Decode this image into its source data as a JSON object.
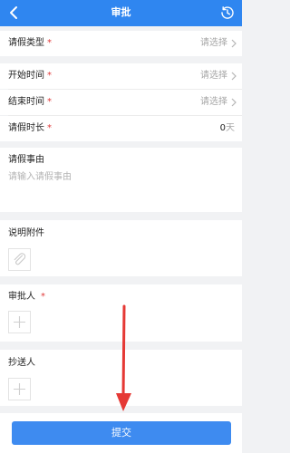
{
  "header": {
    "title": "审批"
  },
  "form": {
    "leave_type": {
      "label": "请假类型",
      "required_mark": "*",
      "value": "请选择"
    },
    "start_time": {
      "label": "开始时间",
      "required_mark": "*",
      "value": "请选择"
    },
    "end_time": {
      "label": "结束时间",
      "required_mark": "*",
      "value": "请选择"
    },
    "duration": {
      "label": "请假时长",
      "required_mark": "*",
      "value": "0",
      "unit": "天"
    },
    "reason": {
      "label": "请假事由",
      "placeholder": "请输入请假事由"
    },
    "attachment": {
      "label": "说明附件"
    },
    "approver": {
      "label": "审批人",
      "required_mark": "*"
    },
    "cc": {
      "label": "抄送人"
    }
  },
  "footer": {
    "submit_label": "提交"
  },
  "colors": {
    "accent": "#2f86f0",
    "required": "#e03a3a",
    "annotation_arrow": "#e53935"
  }
}
